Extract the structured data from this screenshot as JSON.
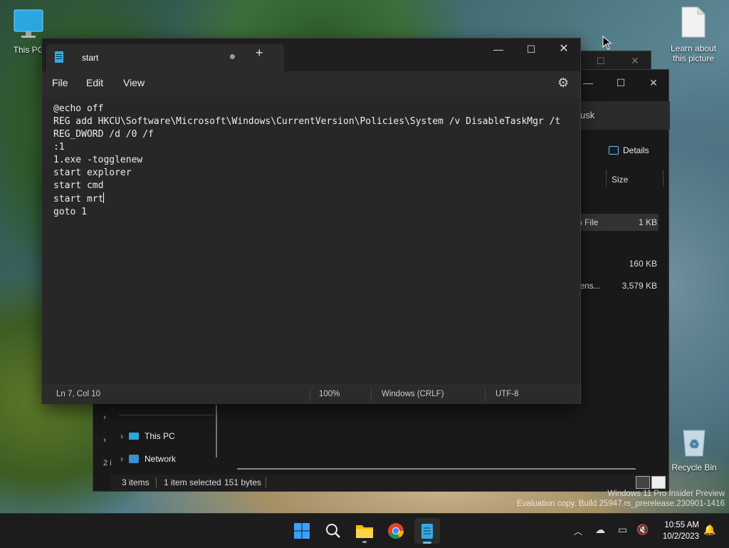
{
  "desktop": {
    "icons": [
      {
        "label": "This PC",
        "icon": "monitor-icon"
      },
      {
        "label": "Learn about this picture",
        "icon": "document-icon"
      },
      {
        "label": "Recycle Bin",
        "icon": "recycle-bin-icon"
      }
    ],
    "watermark_line1": "Windows 11 Pro Insider Preview",
    "watermark_line2": "Evaluation copy. Build 25947.rs_prerelease.230901-1416"
  },
  "explorer": {
    "title_partial": "usk",
    "details_label": "Details",
    "size_header": "Size",
    "rows": [
      {
        "name_partial": "h File",
        "size": "1 KB"
      },
      {
        "name_partial": "",
        "size": "160 KB"
      },
      {
        "name_partial": "tens...",
        "size": "3,579 KB"
      }
    ],
    "nav": [
      {
        "label": "This PC",
        "icon": "pc-icon"
      },
      {
        "label": "Network",
        "icon": "network-icon"
      }
    ],
    "status_items": "3 items",
    "status_selected": "1 item selected",
    "status_size": "151 bytes",
    "back_status": "2 i"
  },
  "notepad": {
    "tab_title": "start",
    "menu": [
      "File",
      "Edit",
      "View"
    ],
    "content_lines": [
      "@echo off",
      "REG add HKCU\\Software\\Microsoft\\Windows\\CurrentVersion\\Policies\\System /v DisableTaskMgr /t",
      "REG_DWORD /d /0 /f",
      ":1",
      "1.exe -togglenew",
      "start explorer",
      "start cmd",
      "start mrt",
      "goto 1"
    ],
    "status": {
      "position": "Ln 7, Col 10",
      "zoom": "100%",
      "line_ending": "Windows (CRLF)",
      "encoding": "UTF-8"
    }
  },
  "taskbar": {
    "apps": [
      "start-icon",
      "search-icon",
      "file-explorer-icon",
      "chrome-icon",
      "notepad-icon"
    ],
    "time": "10:55 AM",
    "date": "10/2/2023"
  }
}
